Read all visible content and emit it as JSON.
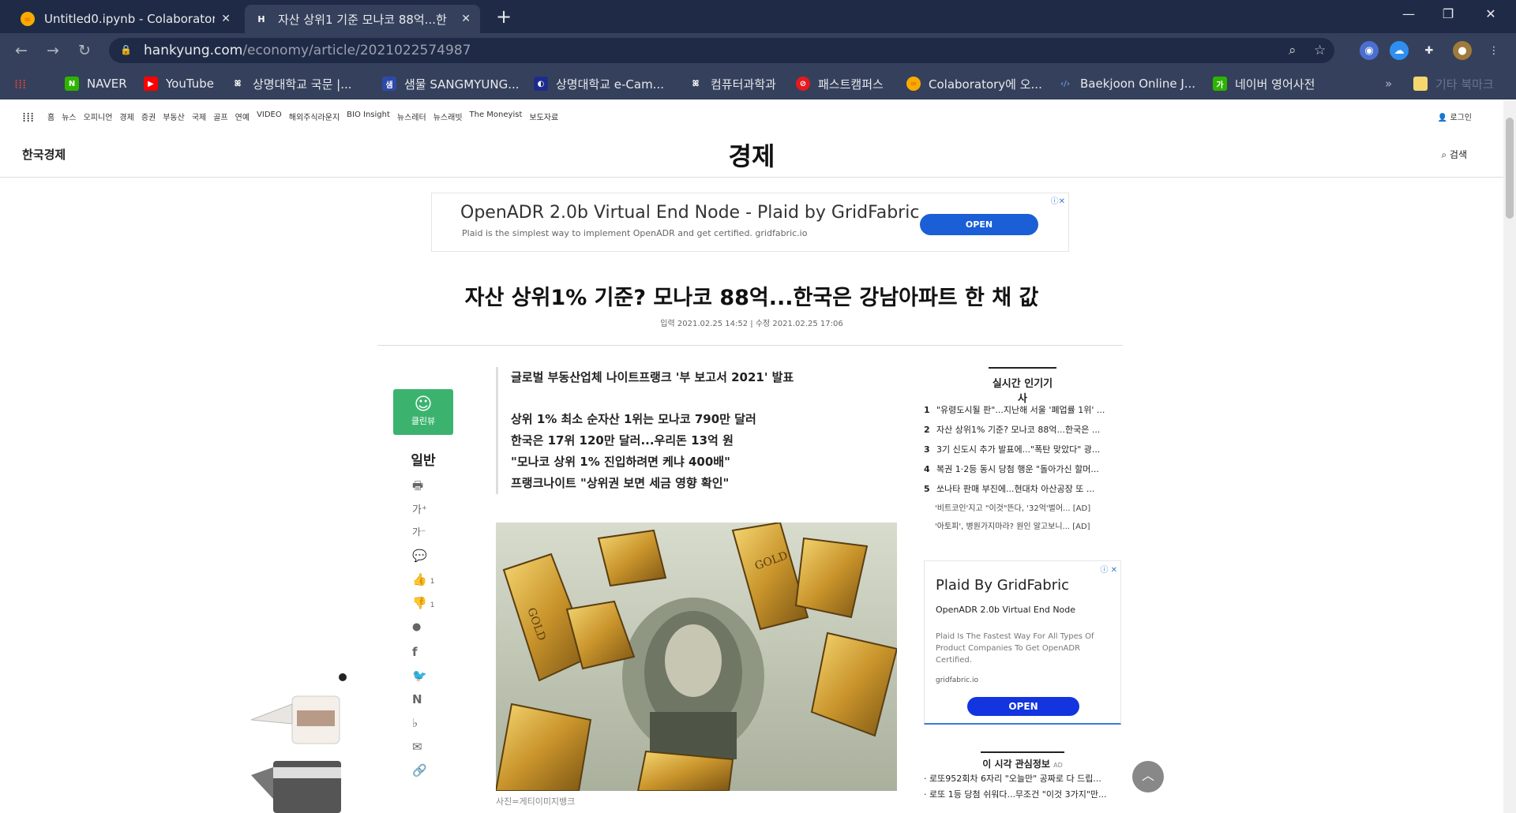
{
  "tabs": [
    {
      "title": "Untitled0.ipynb - Colaboratory",
      "favicon": "colab-icon"
    },
    {
      "title": "자산 상위1 기준 모나코 88억...한",
      "favicon": "H"
    }
  ],
  "window_controls": {
    "minimize": "—",
    "restore": "❐",
    "close": "✕"
  },
  "toolbar": {
    "url_host": "hankyung.com",
    "url_path": "/economy/article/2021022574987"
  },
  "bookmarks": [
    "NAVER",
    "YouTube",
    "상명대학교 국문 |...",
    "샘물 SANGMYUNG...",
    "상명대학교 e-Cam...",
    "컴퓨터과학과",
    "패스트캠퍼스",
    "Colaboratory에 오...",
    "Baekjoon Online J...",
    "네이버 영어사전",
    "기타 북마크"
  ],
  "topnav": {
    "items": [
      "홈",
      "뉴스",
      "오피니언",
      "경제",
      "증권",
      "부동산",
      "국제",
      "골프",
      "연예",
      "VIDEO",
      "해외주식라운지",
      "BIO Insight",
      "뉴스레터",
      "뉴스래빗",
      "The Moneyist",
      "보도자료"
    ],
    "login": "로그인"
  },
  "header": {
    "logo": "한국경제",
    "section": "경제",
    "search": "검색"
  },
  "ad_top": {
    "headline": "OpenADR 2.0b Virtual End Node - Plaid by GridFabric",
    "sub": "Plaid is the simplest way to implement OpenADR and get certified. gridfabric.io",
    "button": "OPEN"
  },
  "article": {
    "headline": "자산 상위1% 기준? 모나코 88억...한국은 강남아파트 한 채 값",
    "dates": "입력 2021.02.25 14:52 | 수정 2021.02.25 17:06",
    "summary_title": "글로벌 부동산업체 나이트프랭크 '부 보고서 2021' 발표",
    "summary": [
      "상위 1% 최소 순자산 1위는 모나코 790만 달러",
      "한국은 17위 120만 달러...우리돈 13억 원",
      "\"모나코 상위 1% 진입하려면 케냐 400배\"",
      "프랭크나이트 \"상위권 보면 세금 영향 확인\""
    ],
    "caption": "사진=게티이미지뱅크"
  },
  "leftbar": {
    "cleanview": "클린뷰",
    "general": "일반",
    "like_count": "1",
    "dislike_count": "1"
  },
  "popular": {
    "title": "실시간 인기기사",
    "items": [
      {
        "n": "1",
        "text": "\"유령도시될 판\"...지난해 서울 '폐업률 1위' ..."
      },
      {
        "n": "2",
        "text": "자산 상위1% 기준? 모나코 88억...한국은 ..."
      },
      {
        "n": "3",
        "text": "3기 신도시 추가 발표에...\"폭탄 맞았다\" 광..."
      },
      {
        "n": "4",
        "text": "복권 1·2등 동시 당첨 행운 \"돌아가신 할머..."
      },
      {
        "n": "5",
        "text": "쏘나타 판매 부진에...현대차 아산공장 또 ..."
      }
    ],
    "ads": [
      "'비트코인'지고 \"이것\"뜬다, '32억'벌어... [AD]",
      "'아토피', 병원가지마라? 원인 알고보니... [AD]"
    ]
  },
  "side_ad": {
    "title": "Plaid By GridFabric",
    "subtitle": "OpenADR 2.0b Virtual End Node",
    "desc": "Plaid Is The Fastest Way For All Types Of Product Companies To Get OpenADR Certified.",
    "domain": "gridfabric.io",
    "button": "OPEN"
  },
  "interest": {
    "title": "이 시각 관심정보",
    "ad": "AD",
    "items": [
      "로또952회차 6자리 \"오늘만\" 공짜로 다 드립...",
      "로또 1등 당첨 쉬워다...무조건 \"이것 3가지\"만..."
    ]
  }
}
